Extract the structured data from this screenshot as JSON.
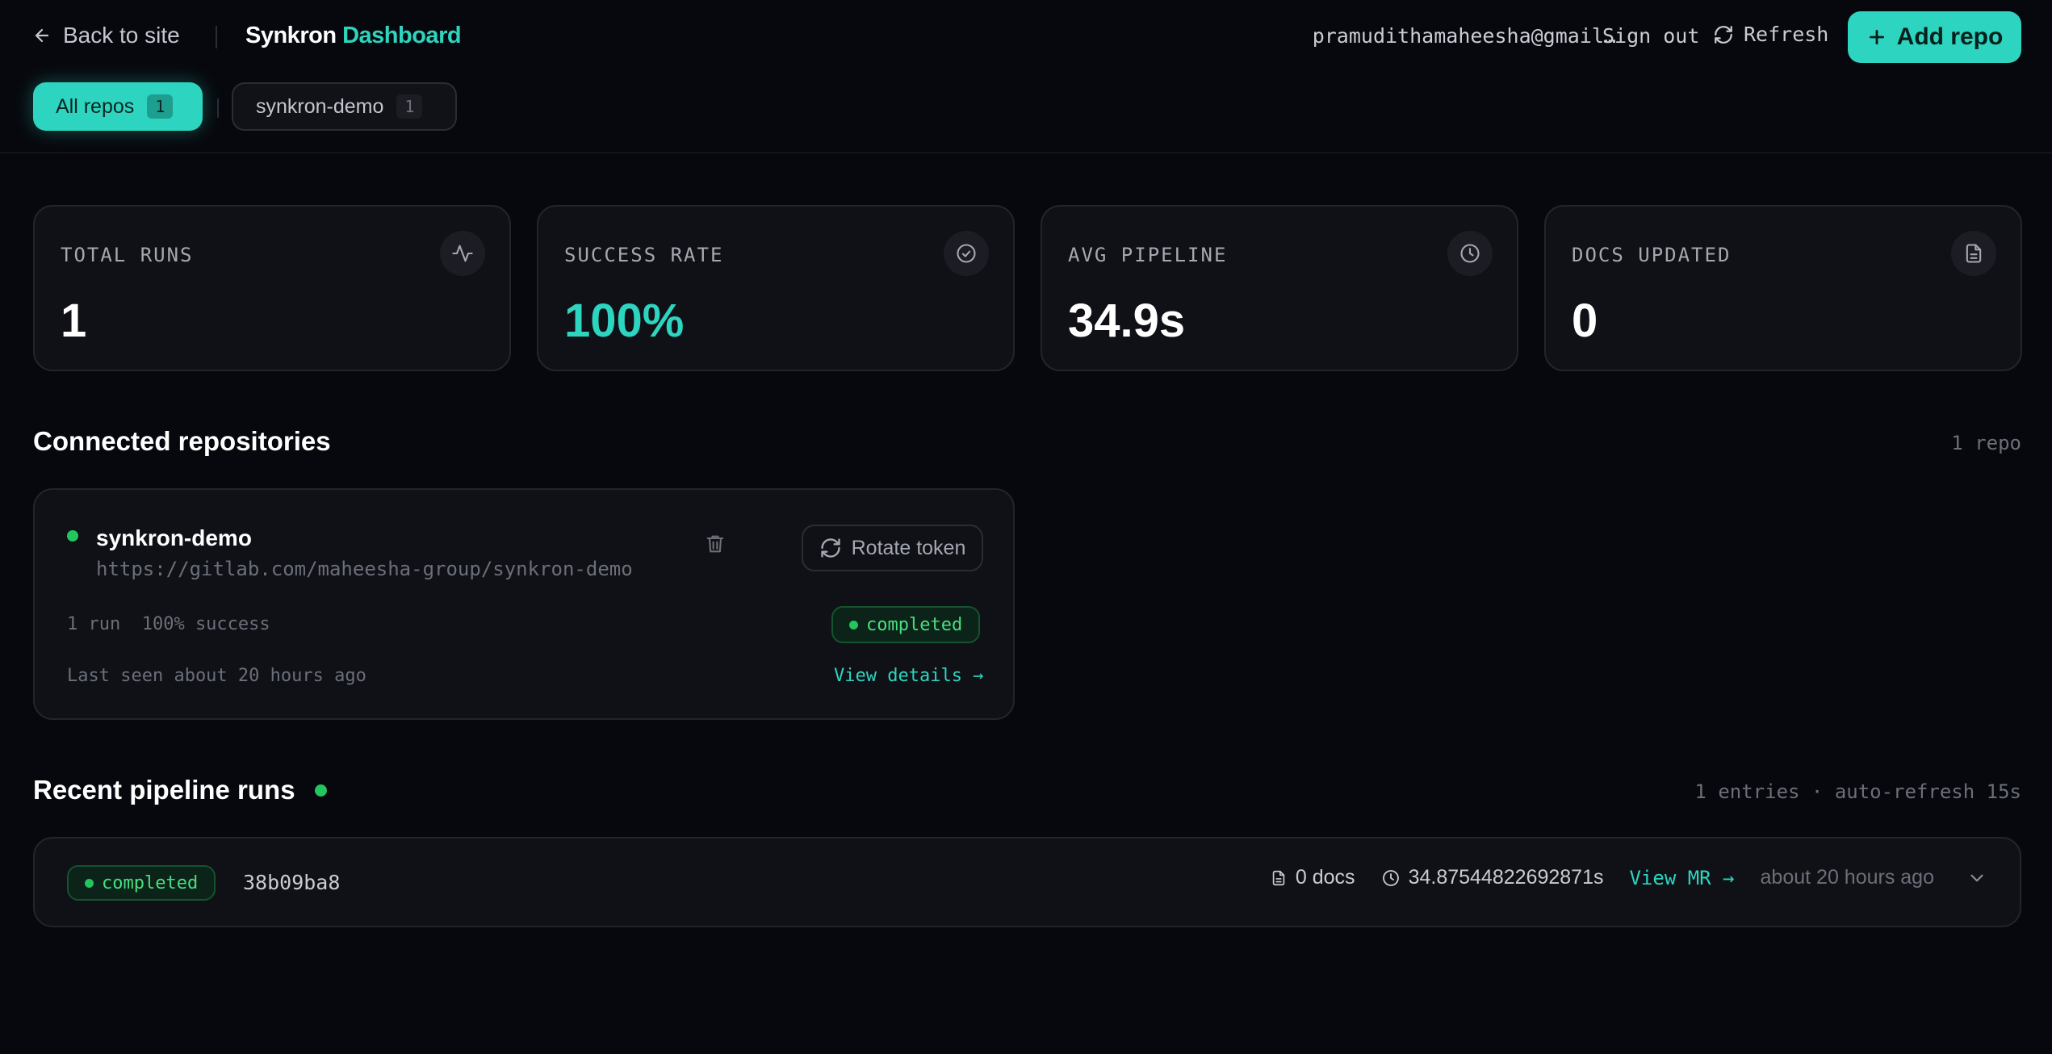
{
  "header": {
    "back_label": "Back to site",
    "brand_name": "Synkron",
    "brand_suffix": "Dashboard",
    "user_email": "pramudithamaheesha@gmail…",
    "sign_out": "Sign out",
    "refresh": "Refresh",
    "add_repo": "Add repo"
  },
  "tabs": [
    {
      "label": "All repos",
      "count": "1",
      "active": true
    },
    {
      "label": "synkron-demo",
      "count": "1",
      "active": false
    }
  ],
  "stats": [
    {
      "label": "TOTAL RUNS",
      "value": "1",
      "icon": "activity-icon"
    },
    {
      "label": "SUCCESS RATE",
      "value": "100%",
      "icon": "check-circle-icon"
    },
    {
      "label": "AVG PIPELINE",
      "value": "34.9s",
      "icon": "clock-icon"
    },
    {
      "label": "DOCS UPDATED",
      "value": "0",
      "icon": "document-icon"
    }
  ],
  "repos_section": {
    "title": "Connected repositories",
    "meta": "1 repo",
    "repo": {
      "name": "synkron-demo",
      "url": "https://gitlab.com/maheesha-group/synkron-demo",
      "rotate_label": "Rotate token",
      "stats": "1 run  100% success",
      "status": "completed",
      "last_seen": "Last seen about 20 hours ago",
      "view_details": "View details →"
    }
  },
  "runs_section": {
    "title": "Recent pipeline runs",
    "meta": "1 entries · auto-refresh 15s",
    "run": {
      "status": "completed",
      "hash": "38b09ba8",
      "docs": "0 docs",
      "duration": "34.87544822692871s",
      "view_mr": "View MR →",
      "time": "about 20 hours ago"
    }
  },
  "colors": {
    "accent": "#2dd4bf",
    "success": "#22c55e",
    "background": "#07080d"
  }
}
